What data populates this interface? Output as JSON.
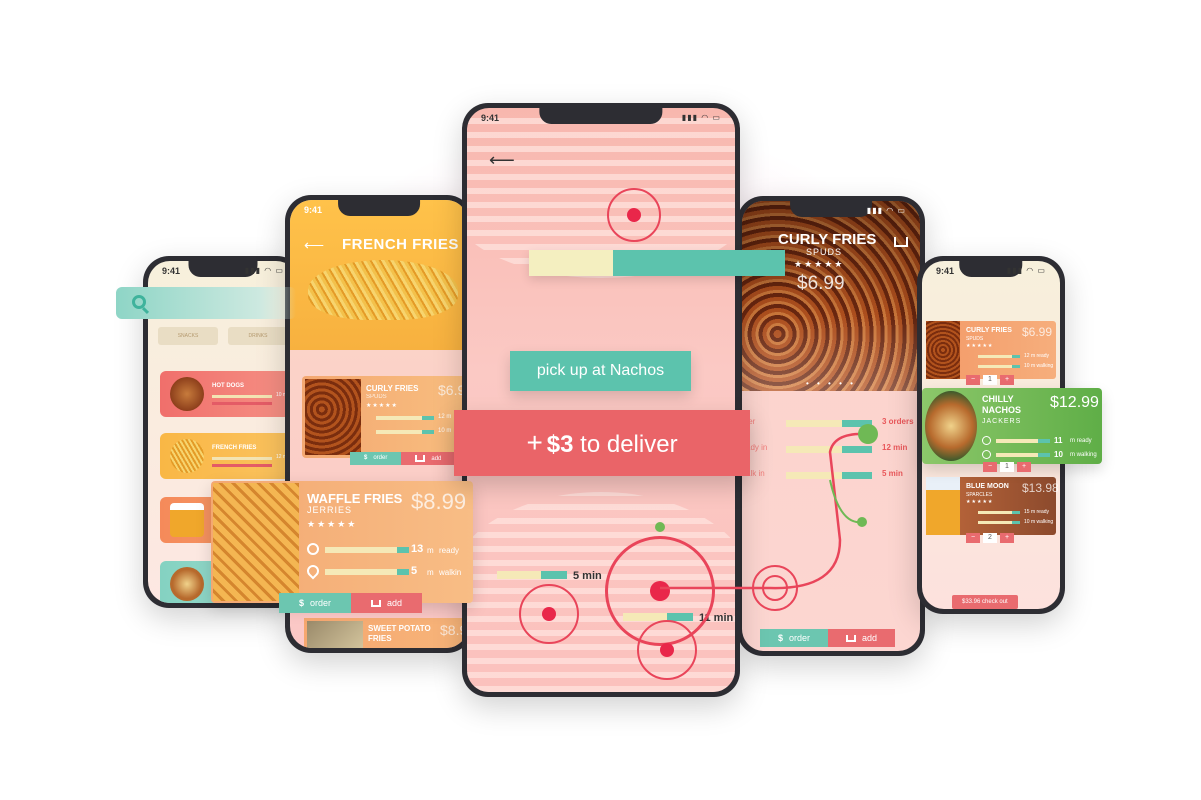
{
  "status_time": "9:41",
  "colors": {
    "teal": "#5cc3ad",
    "coral": "#ea6468",
    "cream": "#f5e9b7",
    "orange": "#f3a872",
    "green": "#6fb955"
  },
  "left_phone": {
    "categories": [
      "SNACKS",
      "DRINKS"
    ],
    "items": [
      {
        "name": "HOT DOGS",
        "metric": "10 min",
        "sub": "walking"
      },
      {
        "name": "FRENCH FRIES",
        "metric": "12 min",
        "sub": "walking"
      },
      {
        "name": "BE",
        "metric": "",
        "sub": ""
      },
      {
        "name": "NA",
        "metric": "",
        "sub": ""
      }
    ]
  },
  "fries_phone": {
    "title": "FRENCH FRIES",
    "curly_card": {
      "name": "CURLY FRIES",
      "vendor": "SPUDS",
      "stars": "★★★★★",
      "price": "$6.9",
      "ready": "12 m",
      "walking": "10 m"
    },
    "order_label": "order",
    "add_label": "add",
    "sweet_card": {
      "name": "SWEET POTATO FRIES",
      "price": "$8.9"
    }
  },
  "waffle_card": {
    "name": "WAFFLE FRIES",
    "vendor": "JERRIES",
    "stars": "★★★★★",
    "price": "$8.99",
    "ready_num": "13",
    "ready_unit": "m",
    "ready_label": "ready",
    "walk_num": "5",
    "walk_unit": "m",
    "walk_label": "walkin",
    "ready_level": 0.85,
    "walk_level": 0.35,
    "order_label": "order",
    "add_label": "add"
  },
  "center_phone": {
    "progress_level": 0.33,
    "pickup_label": "pick up at Nachos",
    "deliver_price": "$3",
    "deliver_label": "to deliver",
    "rows": [
      {
        "time": "5 min"
      },
      {
        "time": "11 min"
      }
    ]
  },
  "curly_phone": {
    "title": "CURLY FRIES",
    "vendor": "SPUDS",
    "stars": "★★★★★",
    "price": "$6.99",
    "dots": "• • • • •",
    "rows": [
      {
        "label": "ter",
        "value": "3 orders"
      },
      {
        "label": "ady in",
        "value": "12 min"
      },
      {
        "label": "alk in",
        "value": "5 min"
      }
    ],
    "order_label": "order",
    "add_label": "add"
  },
  "right_phone": {
    "items": [
      {
        "name": "CURLY FRIES",
        "vendor": "SPUDS",
        "price": "$6.99",
        "ready": "12 m ready",
        "walking": "10 m walking",
        "qty": "1"
      },
      {
        "name": "BLUE MOON",
        "vendor": "SPARCLES",
        "price": "$13.98",
        "ready": "15 m ready",
        "walking": "10 m walking",
        "qty": "2"
      }
    ],
    "checkout_label": "$33.96  check out"
  },
  "nachos_card": {
    "name": "CHILLY NACHOS",
    "vendor": "JACKERS",
    "price": "$12.99",
    "ready_num": "11",
    "ready_label": "m ready",
    "walk_num": "10",
    "walk_label": "m walking",
    "qty": "1"
  }
}
